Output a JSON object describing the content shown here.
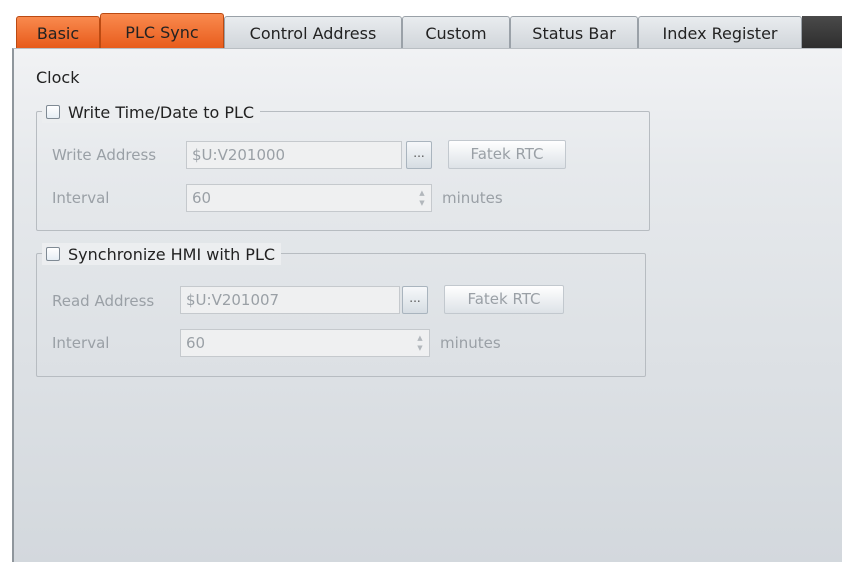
{
  "tabs": [
    {
      "label": "Basic"
    },
    {
      "label": "PLC Sync"
    },
    {
      "label": "Control Address"
    },
    {
      "label": "Custom"
    },
    {
      "label": "Status Bar"
    },
    {
      "label": "Index Register"
    }
  ],
  "selected_tab": "PLC Sync",
  "section_title": "Clock",
  "write_group": {
    "checkbox_label": "Write Time/Date to PLC",
    "checked": false,
    "address_label": "Write Address",
    "address_value": "$U:V201000",
    "browse_label": "...",
    "rtc_button": "Fatek RTC",
    "interval_label": "Interval",
    "interval_value": "60",
    "interval_unit": "minutes"
  },
  "sync_group": {
    "checkbox_label": "Synchronize HMI with PLC",
    "checked": false,
    "address_label": "Read Address",
    "address_value": "$U:V201007",
    "browse_label": "...",
    "rtc_button": "Fatek RTC",
    "interval_label": "Interval",
    "interval_value": "60",
    "interval_unit": "minutes"
  },
  "colors": {
    "tab_accent": "#f26b2a",
    "panel_background": "#e6e9ec",
    "disabled_text": "#9aa0a6"
  }
}
